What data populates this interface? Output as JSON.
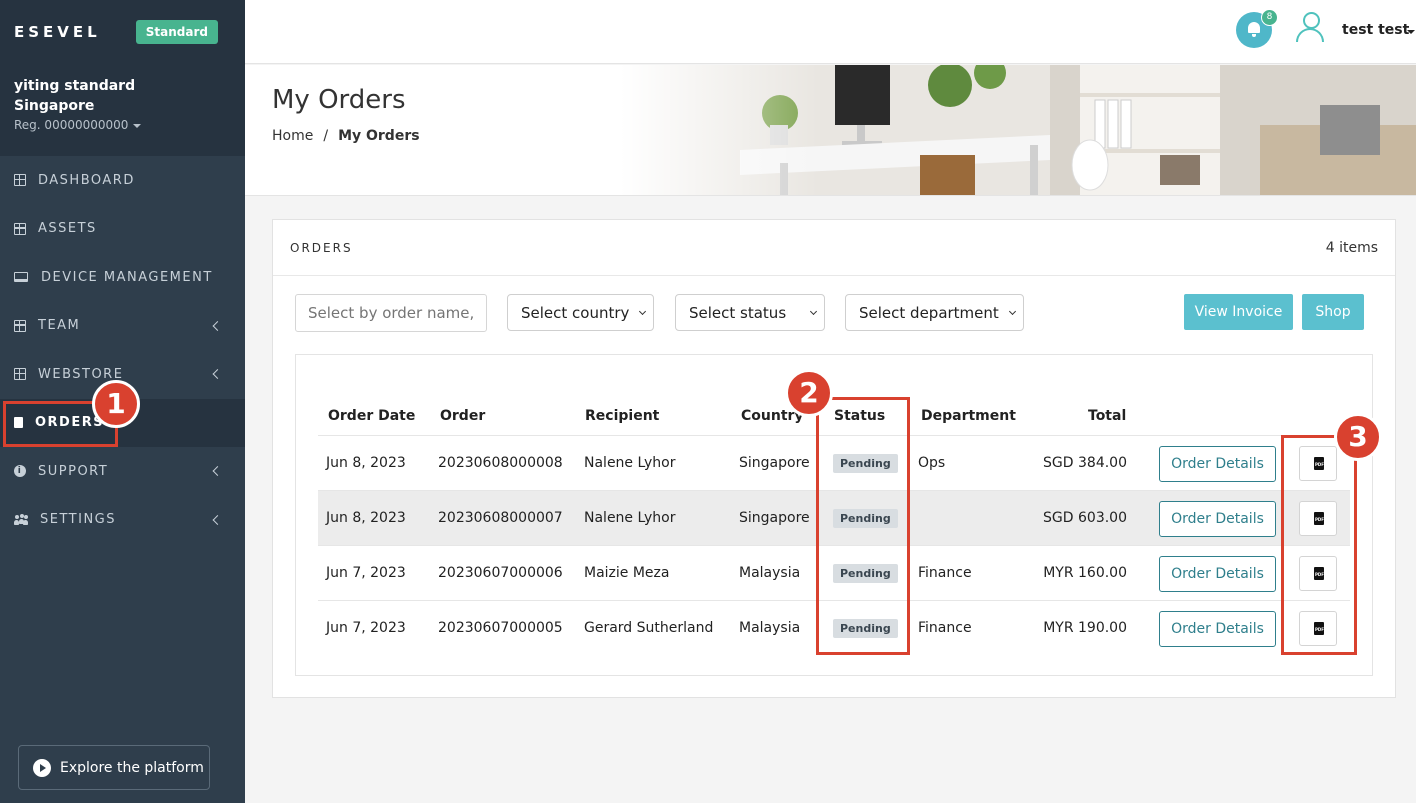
{
  "sidebar": {
    "brand": "ESEVEL",
    "plan_badge": "Standard",
    "org_name_line1": "yiting standard",
    "org_name_line2": "Singapore",
    "org_reg": "Reg. 00000000000",
    "items": [
      {
        "label": "DASHBOARD"
      },
      {
        "label": "ASSETS"
      },
      {
        "label": "DEVICE MANAGEMENT"
      },
      {
        "label": "TEAM"
      },
      {
        "label": "WEBSTORE"
      },
      {
        "label": "ORDERS"
      },
      {
        "label": "SUPPORT"
      },
      {
        "label": "SETTINGS"
      }
    ],
    "explore_label": "Explore the platform"
  },
  "topbar": {
    "notification_count": "8",
    "user_name": "test test"
  },
  "header": {
    "title": "My Orders",
    "breadcrumb_home": "Home",
    "breadcrumb_sep": "/",
    "breadcrumb_current": "My Orders"
  },
  "orders": {
    "title": "ORDERS",
    "count": "4 items",
    "search_placeholder": "Select by order name,",
    "filters": {
      "country": "Select country",
      "status": "Select status",
      "department": "Select department"
    },
    "view_invoice_label": "View Invoice",
    "shop_label": "Shop",
    "columns": [
      "Order Date",
      "Order",
      "Recipient",
      "Country",
      "Status",
      "Department",
      "Total"
    ],
    "details_label": "Order Details",
    "rows": [
      {
        "date": "Jun 8, 2023",
        "order": "20230608000008",
        "recipient": "Nalene Lyhor",
        "country": "Singapore",
        "status": "Pending",
        "department": "Ops",
        "total": "SGD 384.00"
      },
      {
        "date": "Jun 8, 2023",
        "order": "20230608000007",
        "recipient": "Nalene Lyhor",
        "country": "Singapore",
        "status": "Pending",
        "department": "",
        "total": "SGD 603.00"
      },
      {
        "date": "Jun 7, 2023",
        "order": "20230607000006",
        "recipient": "Maizie Meza",
        "country": "Malaysia",
        "status": "Pending",
        "department": "Finance",
        "total": "MYR 160.00"
      },
      {
        "date": "Jun 7, 2023",
        "order": "20230607000005",
        "recipient": "Gerard Sutherland",
        "country": "Malaysia",
        "status": "Pending",
        "department": "Finance",
        "total": "MYR 190.00"
      }
    ]
  },
  "annotations": [
    "1",
    "2",
    "3"
  ],
  "colors": {
    "sidebar_bg": "#2f3e4c",
    "accent_teal": "#5bc0cf",
    "plan_green": "#48b48f",
    "annotation_red": "#d9412f"
  }
}
